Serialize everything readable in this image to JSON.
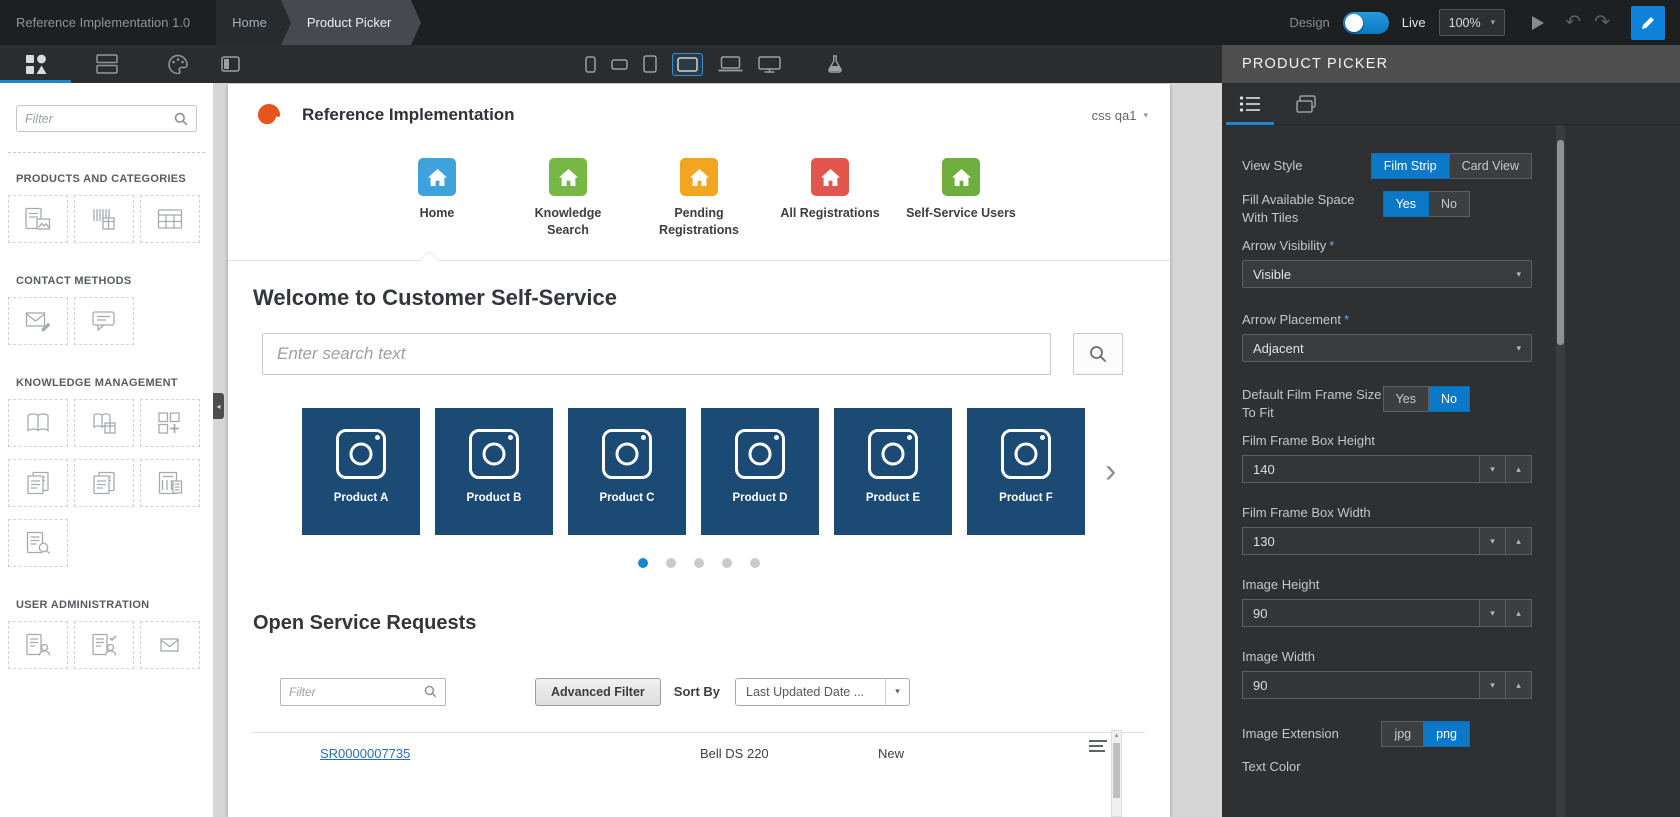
{
  "glyphs": {
    "caret_down": "▾",
    "caret_up": "▴",
    "chevron_right": "›",
    "collapse_left": "◂",
    "undo": "↶",
    "redo": "↷"
  },
  "colors": {
    "accent_blue": "#0e82d8",
    "selected_segment": "#0b79c8",
    "product_tile": "#1b4a74",
    "active_dot": "#1588d1"
  },
  "top_bar": {
    "app_title": "Reference Implementation 1.0",
    "breadcrumb": [
      {
        "label": "Home"
      },
      {
        "label": "Product Picker"
      }
    ],
    "design_label": "Design",
    "live_label": "Live",
    "zoom": "100%"
  },
  "left_panel": {
    "filter_placeholder": "Filter",
    "sections": [
      {
        "title": "PRODUCTS AND CATEGORIES"
      },
      {
        "title": "CONTACT METHODS"
      },
      {
        "title": "KNOWLEDGE MANAGEMENT"
      },
      {
        "title": "USER ADMINISTRATION"
      }
    ]
  },
  "preview": {
    "brand": "Reference Implementation",
    "user_menu": "css qa1",
    "nav": [
      {
        "label": "Home",
        "color": "#3fa2dc"
      },
      {
        "label": "Knowledge Search",
        "color": "#76b843"
      },
      {
        "label": "Pending Registrations",
        "color": "#f2a51f"
      },
      {
        "label": "All Registrations",
        "color": "#e2564d"
      },
      {
        "label": "Self-Service Users",
        "color": "#6fae3e"
      }
    ],
    "welcome_title": "Welcome to Customer Self-Service",
    "search_placeholder": "Enter search text",
    "products": [
      {
        "label": "Product A"
      },
      {
        "label": "Product B"
      },
      {
        "label": "Product C"
      },
      {
        "label": "Product D"
      },
      {
        "label": "Product E"
      },
      {
        "label": "Product F"
      }
    ],
    "dots_count": 5,
    "active_dot_index": 0,
    "open_requests": {
      "title": "Open Service Requests",
      "filter_placeholder": "Filter",
      "advanced_filter_label": "Advanced Filter",
      "sort_by_label": "Sort By",
      "sort_value": "Last Updated Date ...",
      "row": {
        "sr_number": "SR0000007735",
        "product": "Bell DS 220",
        "status": "New"
      }
    }
  },
  "right_panel": {
    "title": "PRODUCT PICKER",
    "fields": {
      "view_style": {
        "label": "View Style",
        "options": [
          "Film Strip",
          "Card View"
        ],
        "selected": "Film Strip"
      },
      "fill_space": {
        "label": "Fill Available Space With Tiles",
        "options": [
          "Yes",
          "No"
        ],
        "selected": "Yes"
      },
      "arrow_visibility": {
        "label": "Arrow Visibility",
        "required": "*",
        "value": "Visible"
      },
      "arrow_placement": {
        "label": "Arrow Placement",
        "required": "*",
        "value": "Adjacent"
      },
      "default_fit": {
        "label": "Default Film Frame Size To Fit",
        "options": [
          "Yes",
          "No"
        ],
        "selected": "No"
      },
      "frame_height": {
        "label": "Film Frame Box Height",
        "value": "140"
      },
      "frame_width": {
        "label": "Film Frame Box Width",
        "value": "130"
      },
      "image_height": {
        "label": "Image Height",
        "value": "90"
      },
      "image_width": {
        "label": "Image Width",
        "value": "90"
      },
      "image_extension": {
        "label": "Image Extension",
        "options": [
          "jpg",
          "png"
        ],
        "selected": "png"
      },
      "text_color": {
        "label": "Text Color"
      }
    }
  }
}
